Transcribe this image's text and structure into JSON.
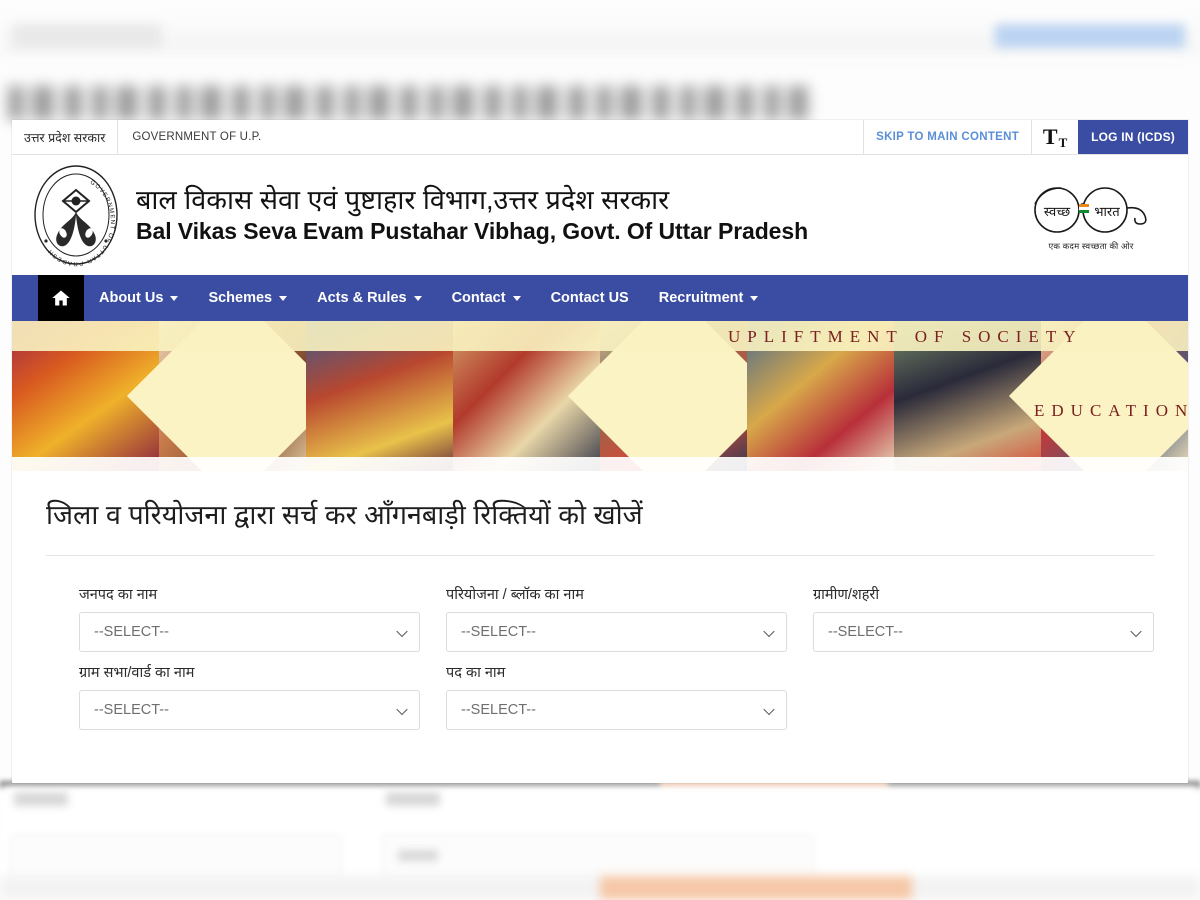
{
  "utility_bar": {
    "gov_label_hi": "उत्तर प्रदेश सरकार",
    "gov_label_en": "GOVERNMENT OF U.P.",
    "skip_link": "SKIP TO MAIN CONTENT",
    "font_size_icon": "text-size-icon",
    "login_button": "LOG IN (ICDS)"
  },
  "masthead": {
    "emblem_text": "GOVERNMENT OF UTTAR PRADESH",
    "title_hi": "बाल विकास सेवा एवं पुष्टाहार विभाग,उत्तर प्रदेश सरकार",
    "title_en": "Bal Vikas Seva Evam Pustahar Vibhag, Govt. Of Uttar Pradesh",
    "swachh_left": "स्वच्छ",
    "swachh_right": "भारत",
    "swachh_tagline": "एक कदम स्वच्छता की ओर"
  },
  "nav": {
    "home_icon": "home-icon",
    "items": [
      {
        "label": "About Us",
        "has_dropdown": true
      },
      {
        "label": "Schemes",
        "has_dropdown": true
      },
      {
        "label": "Acts & Rules",
        "has_dropdown": true
      },
      {
        "label": "Contact",
        "has_dropdown": true
      },
      {
        "label": "Contact US",
        "has_dropdown": false
      },
      {
        "label": "Recruitment",
        "has_dropdown": true
      }
    ]
  },
  "banner": {
    "caption_1": "UPLIFTMENT OF SOCIETY",
    "caption_2": "EDUCATION"
  },
  "search": {
    "heading": "जिला व परियोजना द्वारा सर्च कर आँगनबाड़ी रिक्तियों को खोजें",
    "placeholder": "--SELECT--",
    "fields": [
      {
        "label": "जनपद का नाम",
        "value": "--SELECT--",
        "name": "district-select"
      },
      {
        "label": "परियोजना / ब्लॉक का नाम",
        "value": "--SELECT--",
        "name": "project-block-select"
      },
      {
        "label": "ग्रामीण/शहरी",
        "value": "--SELECT--",
        "name": "rural-urban-select"
      },
      {
        "label": "ग्राम सभा/वार्ड का नाम",
        "value": "--SELECT--",
        "name": "gram-sabha-ward-select"
      },
      {
        "label": "पद का नाम",
        "value": "--SELECT--",
        "name": "post-name-select"
      }
    ]
  },
  "colors": {
    "nav_blue": "#3b4da2",
    "login_blue": "#3b4da2",
    "skip_link_blue": "#5a8fd8",
    "banner_cream": "#fbf3c4",
    "caption_maroon": "#7a2020"
  }
}
